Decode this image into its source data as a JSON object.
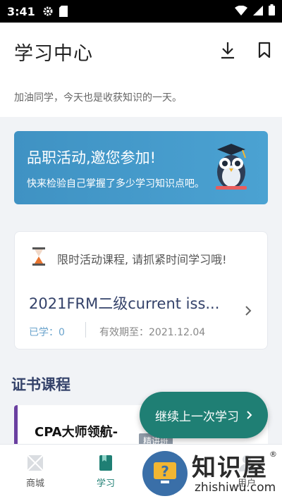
{
  "status_bar": {
    "time": "3:41"
  },
  "header": {
    "title": "学习中心",
    "subtitle": "加油同学，今天也是收获知识的一天。"
  },
  "banner": {
    "title": "品职活动,邀您参加!",
    "subtitle": "快来检验自己掌握了多少学习知识点吧。"
  },
  "course_card": {
    "notice": "限时活动课程, 请抓紧时间学习哦!",
    "course_title": "2021FRM二级current iss...",
    "learned": "已学：0",
    "valid_until": "有效期至：2021.12.04"
  },
  "certificates": {
    "section_title": "证书课程",
    "card_title": "CPA大师领航-",
    "badge": "精讲班"
  },
  "continue_button": {
    "label": "继续上一次学习"
  },
  "bottom_nav": {
    "items": [
      {
        "label": "商城"
      },
      {
        "label": "学习"
      },
      {
        "label": "用户"
      }
    ]
  },
  "watermark": {
    "cn": "知识屋",
    "en": "zhishiwu.com",
    "reg": "®"
  },
  "colors": {
    "accent": "#1f7f74",
    "banner": "#4ba2d2",
    "title_blue": "#34426a"
  }
}
